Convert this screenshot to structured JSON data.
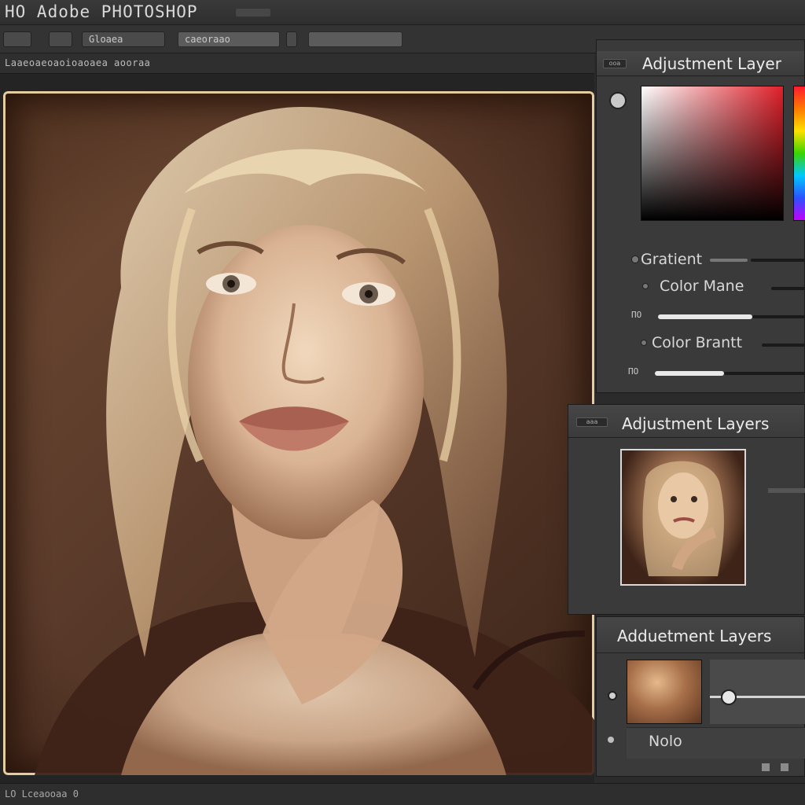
{
  "app": {
    "title": "HO  Adobe PHOTOSHOP"
  },
  "toolbar": {
    "mode_label": "Gloaea",
    "zoom_text": "caeoraao"
  },
  "options_bar": {
    "text": "Laaeoaeoaoioaoaea  aooraa"
  },
  "color_panel": {
    "title": "Adjustment Layer",
    "tab_label": "ooa",
    "items": [
      {
        "label": "Gratient"
      },
      {
        "label": "Color Mane"
      },
      {
        "label": "Color Brantt"
      }
    ],
    "slider_tag_1": "ПО",
    "slider_tag_2": "ПО",
    "slider_values": [
      0.55,
      0.6
    ],
    "colors": {
      "red": "#e0202a",
      "hue_strip": "spectrum"
    }
  },
  "layers_panel": {
    "title": "Adjustment Layers",
    "tab_label": "aaa"
  },
  "adjust_panel": {
    "title": "Adduetment Layers",
    "layer_name": "Nolo",
    "slider_value": 0.2
  },
  "footer": {
    "text": "LO  Lceaooaa  0"
  },
  "icons": {
    "cube": "cube-icon",
    "visibility": "eye-icon"
  }
}
